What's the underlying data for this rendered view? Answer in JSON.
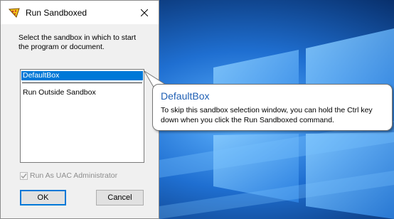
{
  "dialog": {
    "title": "Run Sandboxed",
    "prompt": "Select the sandbox in which to start the program or document.",
    "list_items": [
      "DefaultBox",
      "Run Outside Sandbox"
    ],
    "selected_item": "DefaultBox",
    "uac_checkbox": {
      "label": "Run As UAC Administrator",
      "checked": true,
      "enabled": false
    },
    "ok_label": "OK",
    "cancel_label": "Cancel"
  },
  "tooltip": {
    "title": "DefaultBox",
    "body": "To skip this sandbox selection window, you can hold the Ctrl key down when you click the Run Sandboxed command."
  },
  "icons": {
    "app": "sandboxie-icon",
    "close": "close-icon",
    "check": "checkmark-icon"
  },
  "colors": {
    "selection": "#0078d7",
    "tooltip_title": "#1f5fb4",
    "desktop_background": "#0a3f86"
  }
}
